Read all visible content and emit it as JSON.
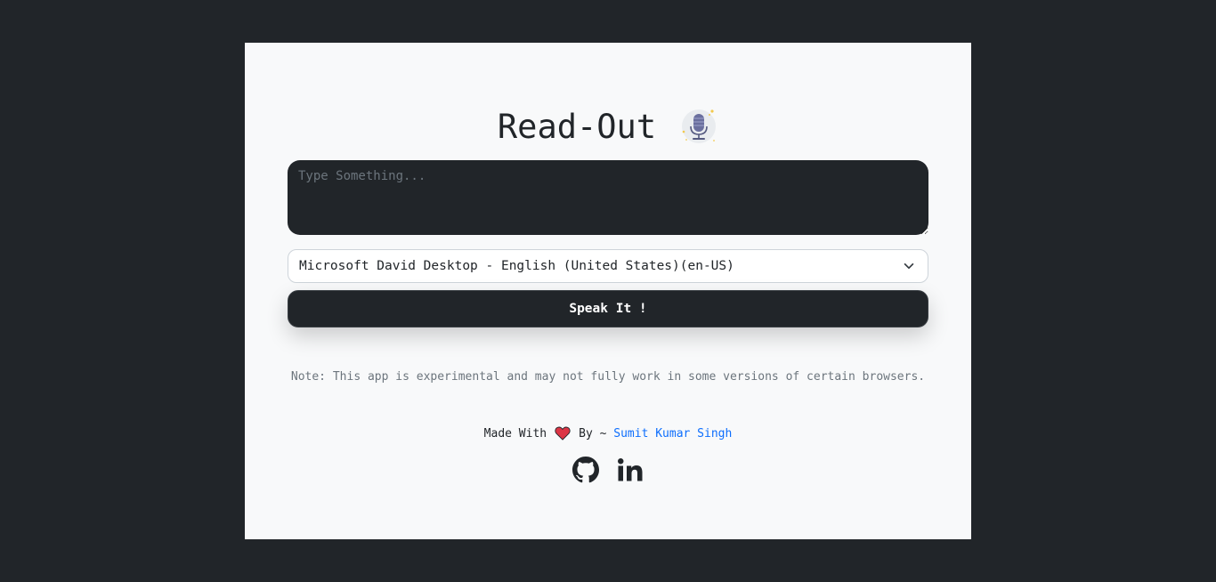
{
  "app": {
    "title": "Read-Out"
  },
  "input": {
    "placeholder": "Type Something...",
    "value": ""
  },
  "voice_select": {
    "selected": "Microsoft David Desktop - English (United States)(en-US)"
  },
  "speak_button": {
    "label": "Speak It !"
  },
  "note": {
    "text": "Note: This app is experimental and may not fully work in some versions of certain browsers."
  },
  "footer": {
    "made_with": "Made With",
    "by": "By ~ ",
    "author": "Sumit Kumar Singh",
    "icons": [
      "heart-icon",
      "github-icon",
      "linkedin-icon"
    ]
  },
  "colors": {
    "page_background": "#212529",
    "card_background": "#f8f9fa",
    "dark": "#212529",
    "link": "#0d6efd",
    "heart": "#dc3545"
  }
}
